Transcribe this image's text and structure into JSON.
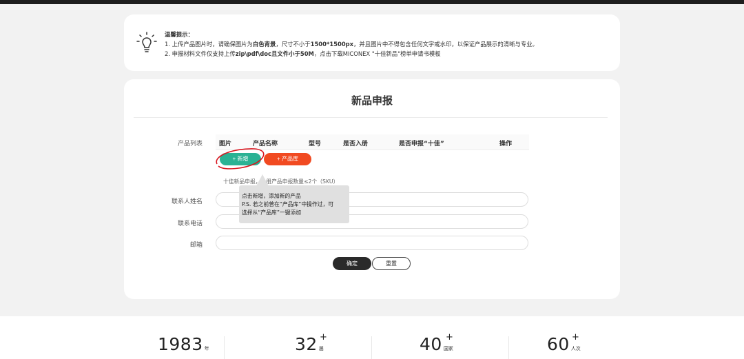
{
  "notice": {
    "title": "温馨提示：",
    "line1_a": "1. 上传产品图片时，请确保图片为",
    "line1_b": "白色背景",
    "line1_c": "，尺寸不小于",
    "line1_d": "1500*1500px",
    "line1_e": "，并且图片中不得包含任何文字或水印，以保证产品展示的清晰与专业。",
    "line2_a": "2. 申报材料文件仅支持上传",
    "line2_b": "zip\\pdf\\doc且文件小于50M",
    "line2_c": "，点击下载MICONEX \"十佳新品\"榜单申请书模板"
  },
  "form": {
    "title": "新品申报",
    "product_list_label": "产品列表",
    "columns": [
      "图片",
      "产品名称",
      "型号",
      "是否入册",
      "是否申报“十佳”",
      "操作"
    ],
    "add_button": "+ 新增",
    "library_button": "+ 产品库",
    "note": "十佳新品申报，入册产品申报数量≤2个（SKU）",
    "contact_name_label": "联系人姓名",
    "contact_phone_label": "联系电话",
    "email_label": "邮箱",
    "contact_name_value": "",
    "contact_phone_value": "",
    "email_value": "",
    "confirm_button": "确定",
    "reset_button": "重置"
  },
  "tooltip": {
    "line1": "点击新增，添加新的产品",
    "line2": "P.S. 若之前曾在“产品库”中操作过，可",
    "line3": "选择从“产品库”一键添加"
  },
  "stats": [
    {
      "number": "1983",
      "unit": "年",
      "plus": ""
    },
    {
      "number": "32",
      "unit": "届",
      "plus": "+"
    },
    {
      "number": "40",
      "unit": "国家",
      "plus": "+"
    },
    {
      "number": "60",
      "unit": "人次",
      "plus": "+"
    }
  ],
  "colors": {
    "add_button": "#2bb294",
    "library_button": "#f14a21",
    "confirm_button": "#2a2a2a",
    "annotation_ellipse": "#d9161f"
  }
}
